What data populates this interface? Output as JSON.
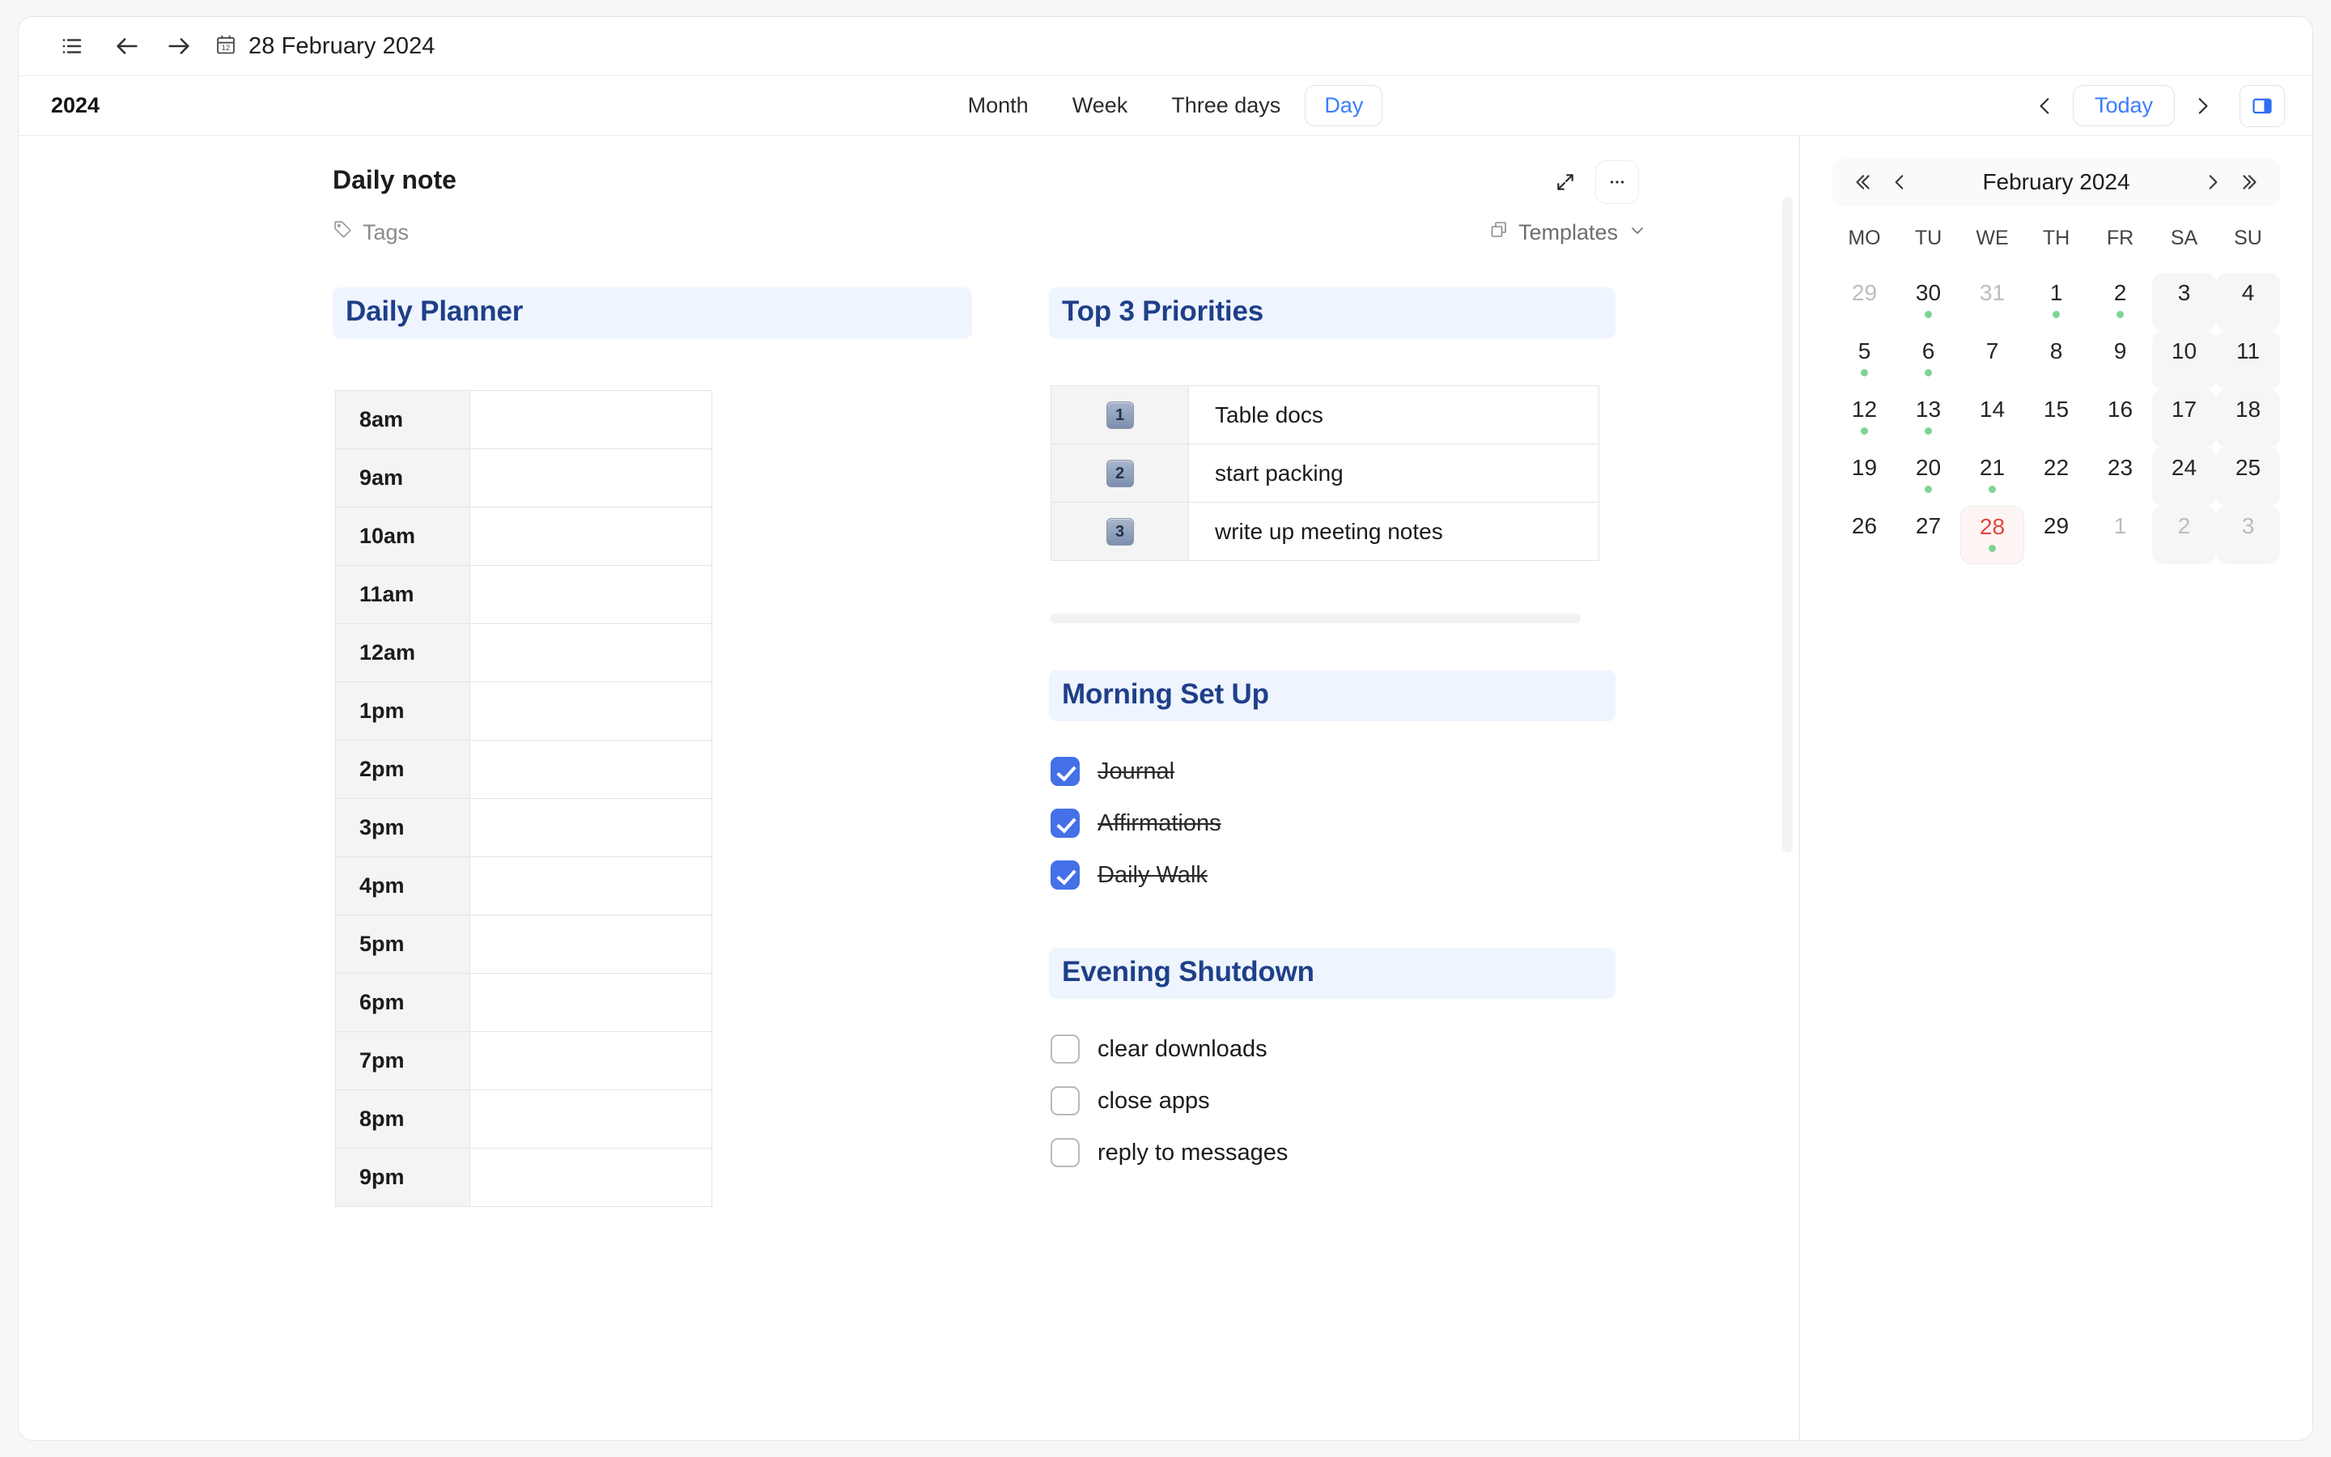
{
  "topbar": {
    "list_icon": "bulleted-list-icon",
    "back_icon": "arrow-left-icon",
    "forward_icon": "arrow-right-icon",
    "calendar_icon": "calendar-icon",
    "date": "28 February 2024"
  },
  "viewbar": {
    "year": "2024",
    "tabs": [
      {
        "label": "Month",
        "active": false
      },
      {
        "label": "Week",
        "active": false
      },
      {
        "label": "Three days",
        "active": false
      },
      {
        "label": "Day",
        "active": true
      }
    ],
    "prev_label": "‹",
    "today_label": "Today",
    "next_label": "›",
    "panel_icon": "side-panel-icon"
  },
  "note": {
    "title": "Daily note",
    "tags_label": "Tags",
    "tag_icon": "tag-icon",
    "expand_icon": "expand-icon",
    "more_icon": "more-horizontal-icon",
    "templates_label": "Templates",
    "templates_icon": "copy-icon",
    "templates_chevron": "chevron-down-icon"
  },
  "planner": {
    "heading": "Daily Planner",
    "rows": [
      {
        "hour": "8am",
        "entry": ""
      },
      {
        "hour": "9am",
        "entry": ""
      },
      {
        "hour": "10am",
        "entry": ""
      },
      {
        "hour": "11am",
        "entry": ""
      },
      {
        "hour": "12am",
        "entry": ""
      },
      {
        "hour": "1pm",
        "entry": ""
      },
      {
        "hour": "2pm",
        "entry": ""
      },
      {
        "hour": "3pm",
        "entry": ""
      },
      {
        "hour": "4pm",
        "entry": ""
      },
      {
        "hour": "5pm",
        "entry": ""
      },
      {
        "hour": "6pm",
        "entry": ""
      },
      {
        "hour": "7pm",
        "entry": ""
      },
      {
        "hour": "8pm",
        "entry": ""
      },
      {
        "hour": "9pm",
        "entry": ""
      }
    ]
  },
  "priorities": {
    "heading": "Top 3 Priorities",
    "rows": [
      {
        "num": "1",
        "task": "Table docs"
      },
      {
        "num": "2",
        "task": "start packing"
      },
      {
        "num": "3",
        "task": "write up meeting notes"
      }
    ]
  },
  "morning": {
    "heading": "Morning Set Up",
    "items": [
      {
        "label": "Journal",
        "checked": true
      },
      {
        "label": "Affirmations",
        "checked": true
      },
      {
        "label": "Daily Walk",
        "checked": true
      }
    ]
  },
  "evening": {
    "heading": "Evening Shutdown",
    "items": [
      {
        "label": "clear downloads",
        "checked": false
      },
      {
        "label": "close apps",
        "checked": false
      },
      {
        "label": "reply to messages",
        "checked": false
      }
    ]
  },
  "minical": {
    "month": "February 2024",
    "first_icon": "chevrons-left-icon",
    "prev_icon": "chevron-left-icon",
    "next_icon": "chevron-right-icon",
    "last_icon": "chevrons-right-icon",
    "dow": [
      "MO",
      "TU",
      "WE",
      "TH",
      "FR",
      "SA",
      "SU"
    ],
    "days": [
      {
        "d": "29",
        "out": true,
        "weekend": false,
        "dot": false,
        "today": false
      },
      {
        "d": "30",
        "out": false,
        "weekend": false,
        "dot": true,
        "today": false
      },
      {
        "d": "31",
        "out": true,
        "weekend": false,
        "dot": false,
        "today": false
      },
      {
        "d": "1",
        "out": false,
        "weekend": false,
        "dot": true,
        "today": false
      },
      {
        "d": "2",
        "out": false,
        "weekend": false,
        "dot": true,
        "today": false
      },
      {
        "d": "3",
        "out": false,
        "weekend": true,
        "dot": false,
        "today": false
      },
      {
        "d": "4",
        "out": false,
        "weekend": true,
        "dot": false,
        "today": false
      },
      {
        "d": "5",
        "out": false,
        "weekend": false,
        "dot": true,
        "today": false
      },
      {
        "d": "6",
        "out": false,
        "weekend": false,
        "dot": true,
        "today": false
      },
      {
        "d": "7",
        "out": false,
        "weekend": false,
        "dot": false,
        "today": false
      },
      {
        "d": "8",
        "out": false,
        "weekend": false,
        "dot": false,
        "today": false
      },
      {
        "d": "9",
        "out": false,
        "weekend": false,
        "dot": false,
        "today": false
      },
      {
        "d": "10",
        "out": false,
        "weekend": true,
        "dot": false,
        "today": false
      },
      {
        "d": "11",
        "out": false,
        "weekend": true,
        "dot": false,
        "today": false
      },
      {
        "d": "12",
        "out": false,
        "weekend": false,
        "dot": true,
        "today": false
      },
      {
        "d": "13",
        "out": false,
        "weekend": false,
        "dot": true,
        "today": false
      },
      {
        "d": "14",
        "out": false,
        "weekend": false,
        "dot": false,
        "today": false
      },
      {
        "d": "15",
        "out": false,
        "weekend": false,
        "dot": false,
        "today": false
      },
      {
        "d": "16",
        "out": false,
        "weekend": false,
        "dot": false,
        "today": false
      },
      {
        "d": "17",
        "out": false,
        "weekend": true,
        "dot": false,
        "today": false
      },
      {
        "d": "18",
        "out": false,
        "weekend": true,
        "dot": false,
        "today": false
      },
      {
        "d": "19",
        "out": false,
        "weekend": false,
        "dot": false,
        "today": false
      },
      {
        "d": "20",
        "out": false,
        "weekend": false,
        "dot": true,
        "today": false
      },
      {
        "d": "21",
        "out": false,
        "weekend": false,
        "dot": true,
        "today": false
      },
      {
        "d": "22",
        "out": false,
        "weekend": false,
        "dot": false,
        "today": false
      },
      {
        "d": "23",
        "out": false,
        "weekend": false,
        "dot": false,
        "today": false
      },
      {
        "d": "24",
        "out": false,
        "weekend": true,
        "dot": false,
        "today": false
      },
      {
        "d": "25",
        "out": false,
        "weekend": true,
        "dot": false,
        "today": false
      },
      {
        "d": "26",
        "out": false,
        "weekend": false,
        "dot": false,
        "today": false
      },
      {
        "d": "27",
        "out": false,
        "weekend": false,
        "dot": false,
        "today": false
      },
      {
        "d": "28",
        "out": false,
        "weekend": false,
        "dot": true,
        "today": true
      },
      {
        "d": "29",
        "out": false,
        "weekend": false,
        "dot": false,
        "today": false
      },
      {
        "d": "1",
        "out": true,
        "weekend": false,
        "dot": false,
        "today": false
      },
      {
        "d": "2",
        "out": true,
        "weekend": true,
        "dot": false,
        "today": false
      },
      {
        "d": "3",
        "out": true,
        "weekend": true,
        "dot": false,
        "today": false
      }
    ]
  },
  "colors": {
    "accent_blue": "#3b7dfb",
    "section_heading": "#1f3f89",
    "section_bg": "#eff5ff",
    "today_red": "#e8453c",
    "dot_green": "#7ed496",
    "checkbox_blue": "#4470e8"
  }
}
